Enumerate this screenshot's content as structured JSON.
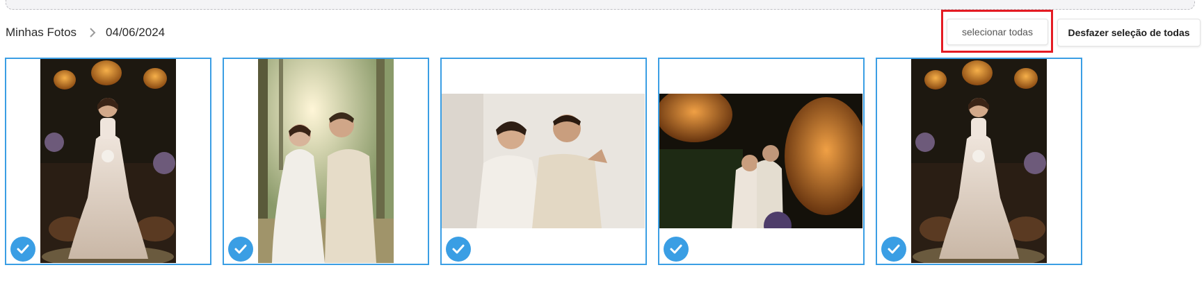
{
  "breadcrumb": {
    "root": "Minhas Fotos",
    "current": "04/06/2024"
  },
  "actions": {
    "select_all": "selecionar todas",
    "deselect_all": "Desfazer seleção de todas"
  },
  "colors": {
    "selection_border": "#3a9ee4",
    "highlight_box": "#e41b23"
  },
  "photos": [
    {
      "subject": "bride portrait with hanging wicker lamps",
      "orientation": "portrait",
      "selected": true
    },
    {
      "subject": "couple embracing among trees at sunset",
      "orientation": "portrait",
      "selected": true
    },
    {
      "subject": "bride and groom back to back",
      "orientation": "landscape",
      "selected": true
    },
    {
      "subject": "couple under dark wicker lamps",
      "orientation": "landscape",
      "selected": true
    },
    {
      "subject": "bride portrait with hanging wicker lamps",
      "orientation": "portrait",
      "selected": true
    }
  ]
}
